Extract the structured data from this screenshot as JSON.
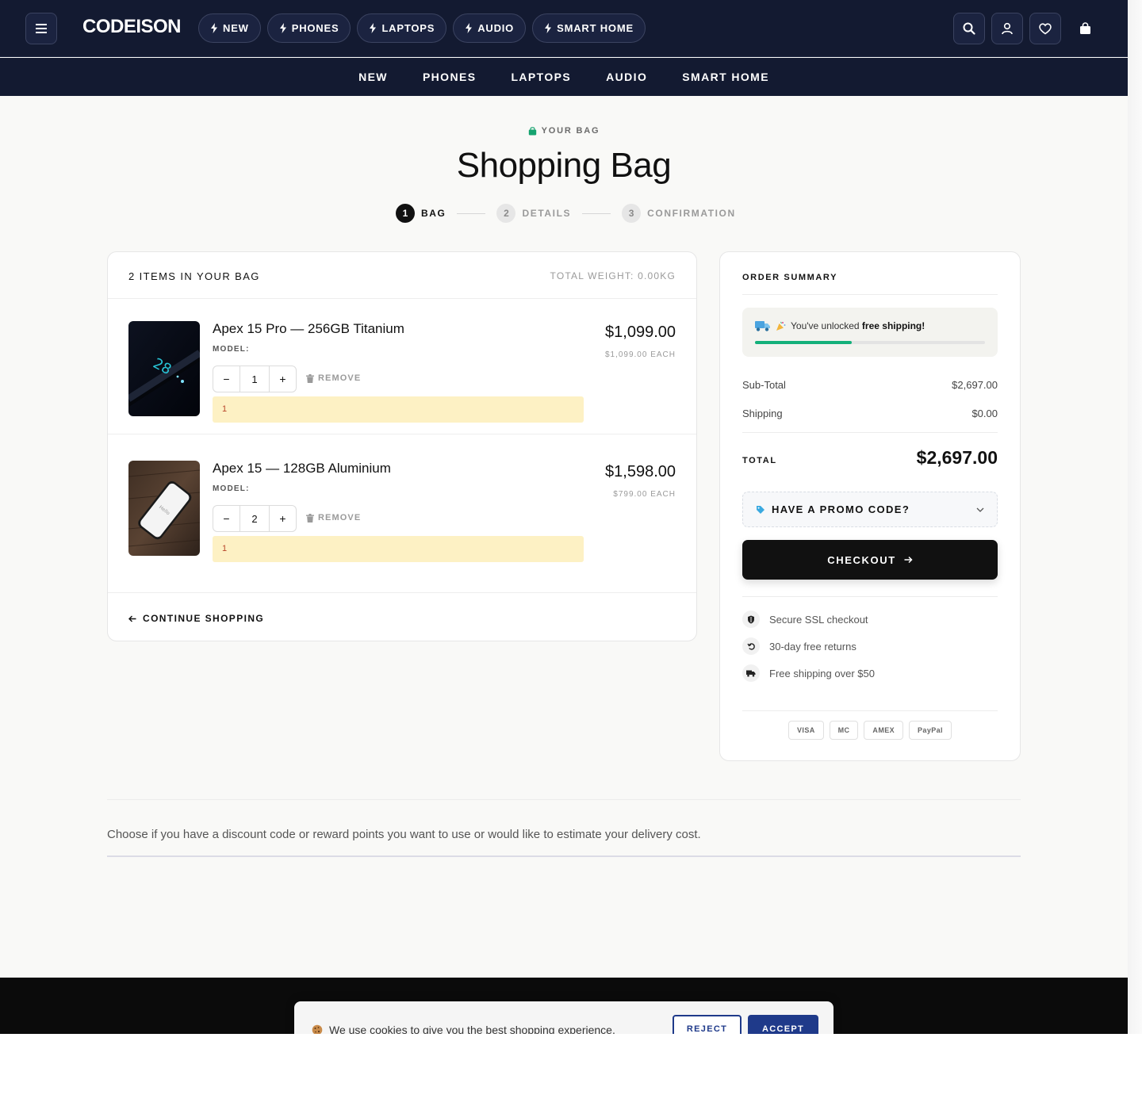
{
  "header": {
    "logo": "CODEISON",
    "pills": [
      {
        "label": "NEW"
      },
      {
        "label": "PHONES"
      },
      {
        "label": "LAPTOPS"
      },
      {
        "label": "AUDIO"
      },
      {
        "label": "SMART HOME"
      }
    ],
    "nav": [
      {
        "label": "NEW"
      },
      {
        "label": "PHONES"
      },
      {
        "label": "LAPTOPS"
      },
      {
        "label": "AUDIO"
      },
      {
        "label": "SMART HOME"
      }
    ],
    "icons": [
      "menu-icon",
      "search-icon",
      "user-icon",
      "heart-icon",
      "bag-icon"
    ]
  },
  "page": {
    "eyebrow": "YOUR BAG",
    "title": "Shopping Bag",
    "steps": [
      {
        "num": "1",
        "label": "BAG",
        "active": true
      },
      {
        "num": "2",
        "label": "DETAILS",
        "active": false
      },
      {
        "num": "3",
        "label": "CONFIRMATION",
        "active": false
      }
    ]
  },
  "bag": {
    "count_label": "2 ITEMS IN YOUR BAG",
    "weight_label": "TOTAL WEIGHT: 0.00KG",
    "items": [
      {
        "name": "Apex 15 Pro — 256GB Titanium",
        "model_label": "MODEL:",
        "qty": "1",
        "remove_label": "REMOVE",
        "notice": "1",
        "price": "$1,099.00",
        "each": "$1,099.00 EACH"
      },
      {
        "name": "Apex 15 — 128GB Aluminium",
        "model_label": "MODEL:",
        "qty": "2",
        "remove_label": "REMOVE",
        "notice": "1",
        "price": "$1,598.00",
        "each": "$799.00 EACH"
      }
    ],
    "qty_minus": "−",
    "qty_plus": "+",
    "continue_label": "CONTINUE SHOPPING"
  },
  "summary": {
    "title": "ORDER SUMMARY",
    "shipping_msg_prefix": "You've unlocked ",
    "shipping_msg_bold": "free shipping!",
    "shipping_progress_percent": 42,
    "subtotal_label": "Sub-Total",
    "subtotal_value": "$2,697.00",
    "shipping_label": "Shipping",
    "shipping_value": "$0.00",
    "total_label": "TOTAL",
    "total_value": "$2,697.00",
    "promo_label": "HAVE A PROMO CODE?",
    "checkout_label": "CHECKOUT",
    "trust": [
      {
        "label": "Secure SSL checkout",
        "icon": "shield-icon"
      },
      {
        "label": "30-day free returns",
        "icon": "return-icon"
      },
      {
        "label": "Free shipping over $50",
        "icon": "truck-icon"
      }
    ],
    "payments": [
      "VISA",
      "MC",
      "AMEX",
      "PayPal"
    ]
  },
  "discount": {
    "text": "Choose if you have a discount code or reward points you want to use or would like to estimate your delivery cost."
  },
  "cookie": {
    "text": "We use cookies to give you the best shopping experience.",
    "reject_label": "REJECT",
    "accept_label": "ACCEPT"
  },
  "colors": {
    "header_bg": "#131a31",
    "accent_green": "#13b07a",
    "notice_bg": "#fdf1c4",
    "cookie_accent": "#1f3a8a"
  }
}
